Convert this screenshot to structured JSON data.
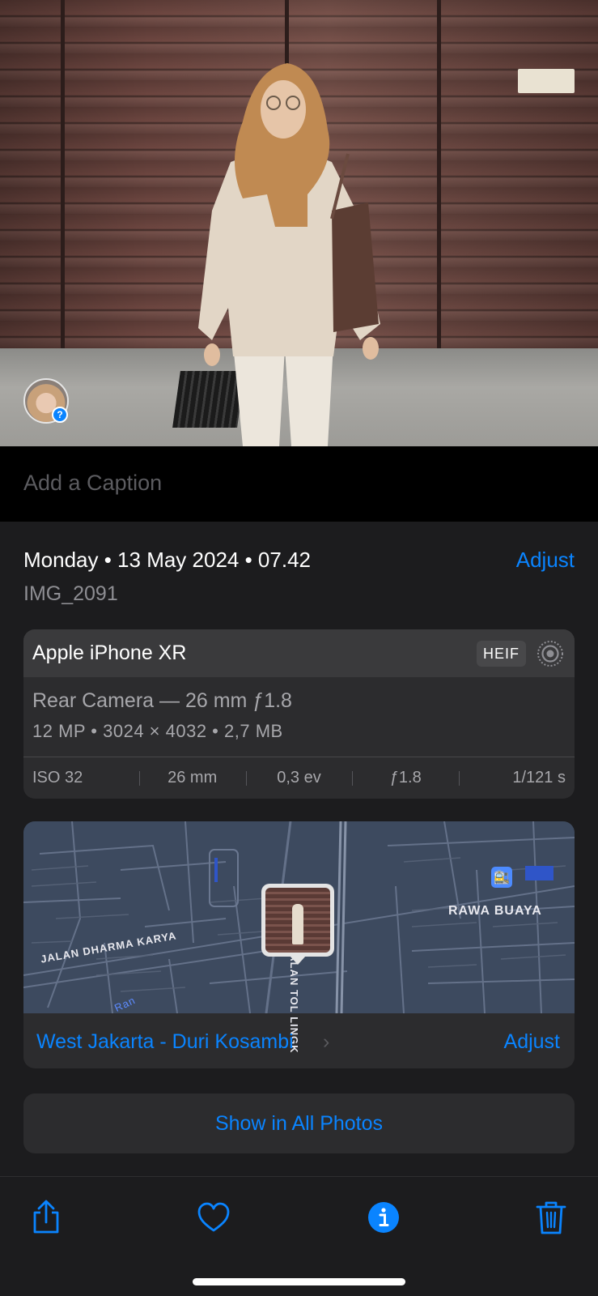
{
  "caption": {
    "placeholder": "Add a Caption"
  },
  "info": {
    "datetime": "Monday • 13 May 2024 • 07.42",
    "adjust_label": "Adjust",
    "filename": "IMG_2091"
  },
  "camera": {
    "model": "Apple iPhone XR",
    "format_badge": "HEIF",
    "lens": "Rear Camera — 26 mm ƒ1.8",
    "specs": "12 MP  •  3024 × 4032  •  2,7 MB",
    "exif": [
      "ISO 32",
      "26 mm",
      "0,3 ev",
      "ƒ1.8",
      "1/121 s"
    ]
  },
  "map": {
    "labels": {
      "road_1": "JALAN DHARMA KARYA",
      "road_2": "JALAN TOL LINGK",
      "area": "RAWA BUAYA",
      "partial": "Ran"
    },
    "location": "West Jakarta - Duri Kosambi",
    "adjust_label": "Adjust"
  },
  "show_all_label": "Show in All Photos",
  "toolbar": {
    "icons": [
      "share-icon",
      "heart-icon",
      "info-icon",
      "trash-icon"
    ],
    "accent": "#0a84ff"
  },
  "colors": {
    "accent": "#0a84ff",
    "background": "#1c1c1e",
    "card": "#2c2c2e"
  }
}
